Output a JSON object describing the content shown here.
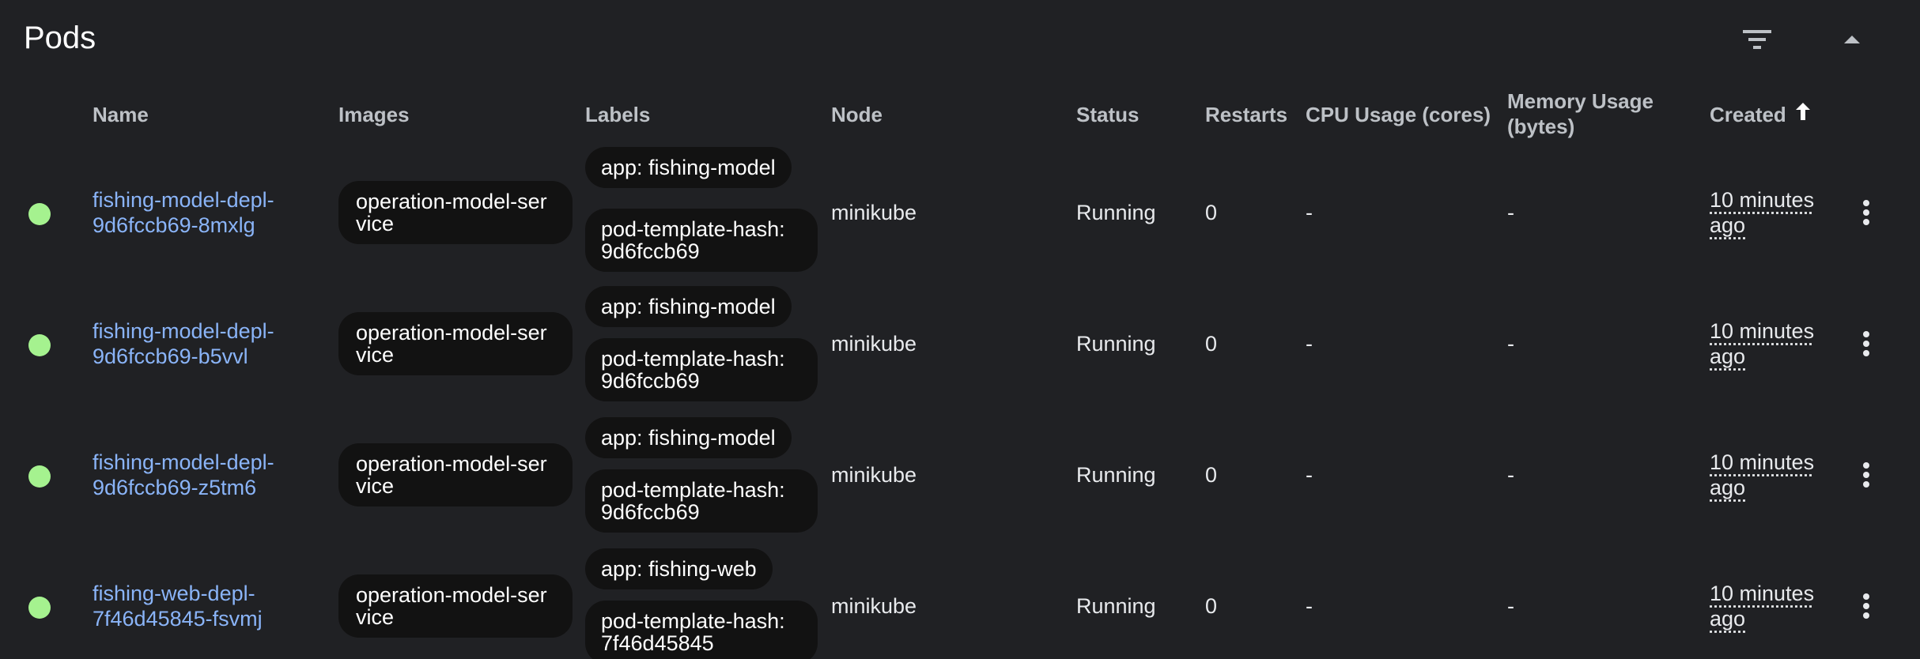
{
  "panel": {
    "title": "Pods"
  },
  "icons": {
    "filter": "filter-list-icon",
    "collapse": "expand-less-icon",
    "sort": "arrow-upward-icon",
    "row_menu": "more-vert-icon"
  },
  "colors": {
    "background": "#202124",
    "link": "#8ab4f8",
    "status_running": "#a5f28f",
    "chip_bg": "#121212"
  },
  "columns": {
    "name": "Name",
    "images": "Images",
    "labels": "Labels",
    "node": "Node",
    "status": "Status",
    "restarts": "Restarts",
    "cpu": "CPU Usage (cores)",
    "memory_line1": "Memory Usage",
    "memory_line2": "(bytes)",
    "created": "Created"
  },
  "pods": [
    {
      "name": "fishing-model-depl-9d6fccb69-8mxlg",
      "image": "operation-model-service",
      "label_app": "app: fishing-model",
      "label_hash": "pod-template-hash: 9d6fccb69",
      "node": "minikube",
      "status": "Running",
      "restarts": "0",
      "cpu": "-",
      "memory": "-",
      "created": "10 minutes ago"
    },
    {
      "name": "fishing-model-depl-9d6fccb69-b5vvl",
      "image": "operation-model-service",
      "label_app": "app: fishing-model",
      "label_hash": "pod-template-hash: 9d6fccb69",
      "node": "minikube",
      "status": "Running",
      "restarts": "0",
      "cpu": "-",
      "memory": "-",
      "created": "10 minutes ago"
    },
    {
      "name": "fishing-model-depl-9d6fccb69-z5tm6",
      "image": "operation-model-service",
      "label_app": "app: fishing-model",
      "label_hash": "pod-template-hash: 9d6fccb69",
      "node": "minikube",
      "status": "Running",
      "restarts": "0",
      "cpu": "-",
      "memory": "-",
      "created": "10 minutes ago"
    },
    {
      "name": "fishing-web-depl-7f46d45845-fsvmj",
      "image": "operation-model-service",
      "label_app": "app: fishing-web",
      "label_hash": "pod-template-hash: 7f46d45845",
      "node": "minikube",
      "status": "Running",
      "restarts": "0",
      "cpu": "-",
      "memory": "-",
      "created": "10 minutes ago"
    }
  ]
}
